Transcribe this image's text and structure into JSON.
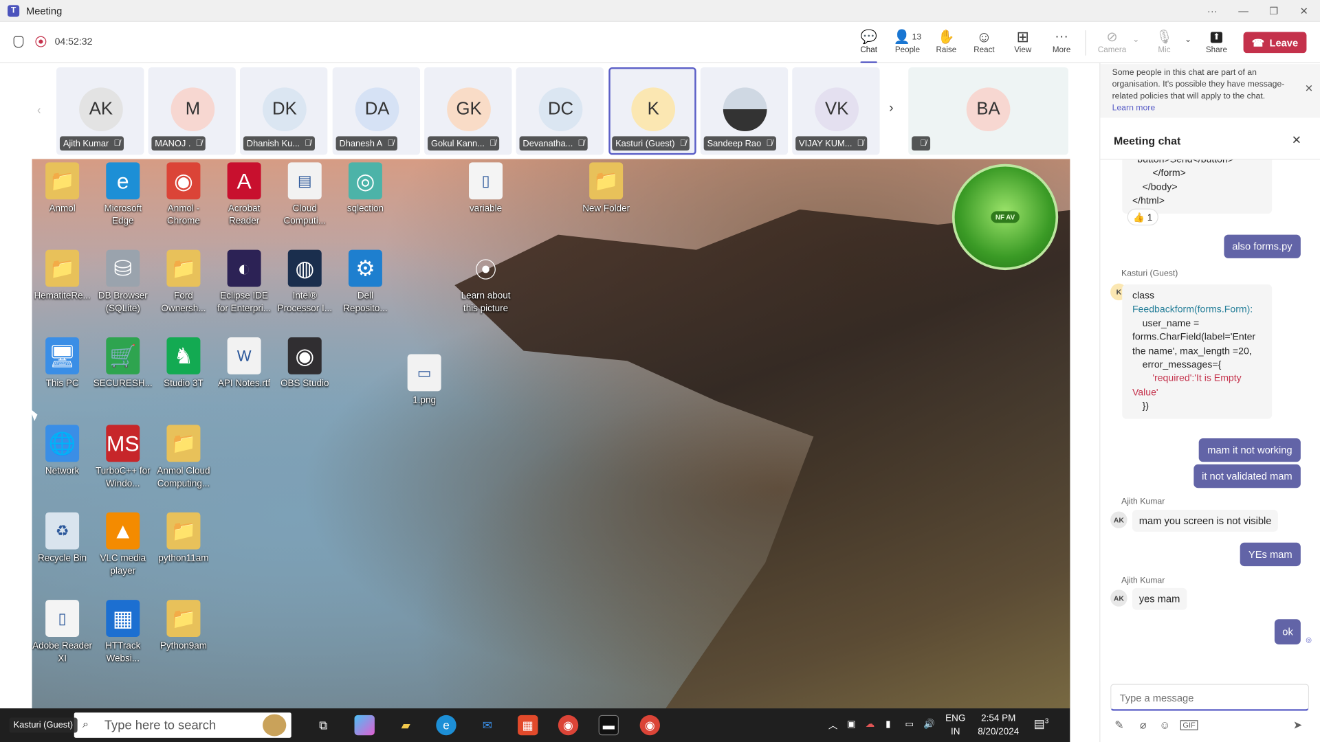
{
  "window": {
    "title": "Meeting",
    "controls": [
      "···",
      "—",
      "❐",
      "✕"
    ]
  },
  "toolbar": {
    "timer": "04:52:32",
    "buttons": [
      {
        "label": "Chat",
        "icon": "chat-icon",
        "glyph": "💬"
      },
      {
        "label": "People",
        "icon": "people-icon",
        "glyph": "👤",
        "count": "13"
      },
      {
        "label": "Raise",
        "icon": "raise-hand-icon",
        "glyph": "✋"
      },
      {
        "label": "React",
        "icon": "react-icon",
        "glyph": "☺"
      },
      {
        "label": "View",
        "icon": "view-icon",
        "glyph": "⊞"
      },
      {
        "label": "More",
        "icon": "more-icon",
        "glyph": "···"
      },
      {
        "label": "Camera",
        "icon": "camera-off-icon",
        "glyph": "⊘"
      },
      {
        "label": "Mic",
        "icon": "mic-off-icon",
        "glyph": "🎙"
      },
      {
        "label": "Share",
        "icon": "share-icon",
        "glyph": "⬆"
      }
    ],
    "leave_label": "Leave"
  },
  "participants": [
    {
      "initials": "AK",
      "name": "Ajith Kumar",
      "color": "#e3e3e3"
    },
    {
      "initials": "M",
      "name": "MANOJ .",
      "color": "#f7d7d1"
    },
    {
      "initials": "DK",
      "name": "Dhanish Ku...",
      "color": "#dbe6f2"
    },
    {
      "initials": "DA",
      "name": "Dhanesh A",
      "color": "#d6e2f5"
    },
    {
      "initials": "GK",
      "name": "Gokul Kann...",
      "color": "#f9dcc7"
    },
    {
      "initials": "DC",
      "name": "Devanatha...",
      "color": "#dbe6f2"
    },
    {
      "initials": "K",
      "name": "Kasturi (Guest)",
      "color": "#fbe7b2"
    },
    {
      "initials": "",
      "name": "Sandeep Rao",
      "color": "#cfd8e3"
    },
    {
      "initials": "VK",
      "name": "VIJAY KUM...",
      "color": "#e4e0f0"
    },
    {
      "initials": "BA",
      "name": "",
      "color": "#f7d7d1"
    }
  ],
  "desktop_icons": [
    {
      "label": "Anmol",
      "glyph": "📁",
      "bg": "#e8c15a"
    },
    {
      "label": "Microsoft Edge",
      "glyph": "e",
      "bg": "#1d8fd6"
    },
    {
      "label": "Anmol - Chrome",
      "glyph": "◉",
      "bg": "#db4437"
    },
    {
      "label": "Acrobat Reader",
      "glyph": "A",
      "bg": "#c8102e"
    },
    {
      "label": "Cloud Computi...",
      "glyph": "▤",
      "bg": "#f2f2f2"
    },
    {
      "label": "sqlection",
      "glyph": "◎",
      "bg": "#4cb3a8"
    },
    {
      "label": "variable",
      "glyph": "▯",
      "bg": "#f4f4f4"
    },
    {
      "label": "New Folder",
      "glyph": "📁",
      "bg": "#e8c15a"
    },
    {
      "label": "HematiteRe...",
      "glyph": "📁",
      "bg": "#e8c15a"
    },
    {
      "label": "DB Browser (SQLite)",
      "glyph": "⛁",
      "bg": "#9aa3ad"
    },
    {
      "label": "Ford Ownersh...",
      "glyph": "📁",
      "bg": "#e8c15a"
    },
    {
      "label": "Eclipse IDE for Enterpri...",
      "glyph": "◐",
      "bg": "#2c2255"
    },
    {
      "label": "Intel® Processor I...",
      "glyph": "◍",
      "bg": "#1a2e4d"
    },
    {
      "label": "Dell Reposito...",
      "glyph": "⚙",
      "bg": "#1e7fcf"
    },
    {
      "label": "Learn about this picture",
      "glyph": "⦿",
      "bg": "transparent"
    },
    {
      "label": "This PC",
      "glyph": "🖥",
      "bg": "#3a8ee6"
    },
    {
      "label": "SECURESH...",
      "glyph": "🛒",
      "bg": "#2ea44f"
    },
    {
      "label": "Studio 3T",
      "glyph": "♞",
      "bg": "#13aa52"
    },
    {
      "label": "API Notes.rtf",
      "glyph": "W",
      "bg": "#f2f2f2"
    },
    {
      "label": "OBS Studio",
      "glyph": "◉",
      "bg": "#302e31"
    },
    {
      "label": "1.png",
      "glyph": "▭",
      "bg": "#f2f2f2"
    },
    {
      "label": "Network",
      "glyph": "🌐",
      "bg": "#3a8ee6"
    },
    {
      "label": "TurboC++ for Windo...",
      "glyph": "MS",
      "bg": "#c7262a"
    },
    {
      "label": "Anmol Cloud Computing...",
      "glyph": "📁",
      "bg": "#e8c15a"
    },
    {
      "label": "Recycle Bin",
      "glyph": "♻",
      "bg": "#d9e4ee"
    },
    {
      "label": "VLC media player",
      "glyph": "▲",
      "bg": "#f48b00"
    },
    {
      "label": "python11am",
      "glyph": "📁",
      "bg": "#e8c15a"
    },
    {
      "label": "Adobe Reader XI",
      "glyph": "▯",
      "bg": "#f4f4f4"
    },
    {
      "label": "HTTrack Websi...",
      "glyph": "▦",
      "bg": "#1c6fd1"
    },
    {
      "label": "Python9am",
      "glyph": "📁",
      "bg": "#e8c15a"
    }
  ],
  "taskbar": {
    "search_placeholder": "Type here to search",
    "language": "ENG",
    "region": "IN",
    "time": "2:54 PM",
    "date": "8/20/2024",
    "notifications": "3",
    "guest_tag": "Kasturi (Guest)"
  },
  "chat": {
    "notice": "Some people in this chat are part of an organisation. It's possible they have message-related policies that will apply to the chat.",
    "notice_link": "Learn more",
    "title": "Meeting chat",
    "code_tail": [
      "button>Send</button>",
      "</form>",
      "</body>",
      "</html>"
    ],
    "reaction": "👍 1",
    "messages": [
      {
        "dir": "out",
        "text": "also forms.py"
      },
      {
        "dir": "in",
        "sender": "Kasturi (Guest)",
        "avatar": "K"
      },
      {
        "dir": "out",
        "text": "mam it not working"
      },
      {
        "dir": "out",
        "text": "it not validated mam"
      },
      {
        "dir": "in",
        "sender": "Ajith Kumar",
        "avatar": "AK",
        "text": "mam you screen is not visible"
      },
      {
        "dir": "out",
        "text": "YEs mam"
      },
      {
        "dir": "in",
        "sender": "Ajith Kumar",
        "avatar": "AK",
        "text": "yes mam"
      },
      {
        "dir": "out",
        "text": "ok"
      }
    ],
    "code_lines": [
      [
        "class",
        ""
      ],
      [
        "Feedbackform(forms.Form):",
        "kw"
      ],
      [
        "user_name =",
        ""
      ],
      [
        "forms.CharField(label='Enter",
        "mix"
      ],
      [
        "the name', max_length =20,",
        "mix2"
      ],
      [
        "error_messages={",
        ""
      ],
      [
        "'required':'It is Empty",
        "st"
      ],
      [
        "Value'",
        "st"
      ],
      [
        "})",
        ""
      ]
    ],
    "composer_placeholder": "Type a message"
  },
  "colors": {
    "accent": "#5b5fc7",
    "leave": "#c4314b",
    "bubble_out": "#6264a7"
  }
}
